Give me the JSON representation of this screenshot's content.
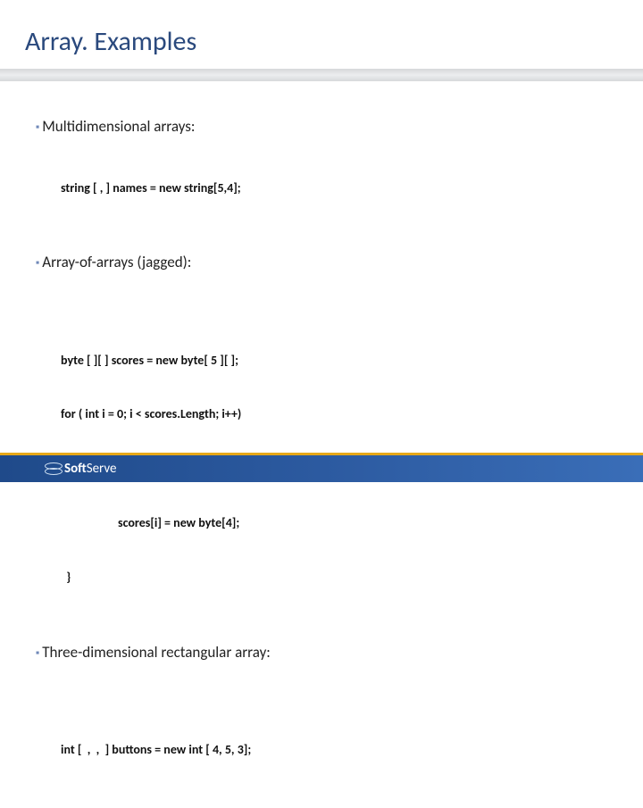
{
  "title": "Array. Examples",
  "sections": [
    {
      "heading": "Multidimensional arrays:",
      "code": [
        {
          "cls": "indent1",
          "text": "string [ , ] names = new string[5,4];"
        }
      ]
    },
    {
      "heading": "Array-of-arrays (jagged):",
      "code": [
        {
          "cls": "indent1",
          "text": ""
        },
        {
          "cls": "indent1",
          "text": "byte [ ][ ] scores = new byte[ 5 ][ ];"
        },
        {
          "cls": "indent1",
          "text": "for ( int i = 0; i < scores.Length; i++)"
        },
        {
          "cls": "indent1",
          "text": "{"
        },
        {
          "cls": "indent2",
          "text": "scores[i] = new byte[4];"
        },
        {
          "cls": "indent1",
          "text": "  }"
        }
      ]
    },
    {
      "heading": "Three-dimensional rectangular array:",
      "code": [
        {
          "cls": "indent1",
          "text": ""
        },
        {
          "cls": "indent1",
          "text": "int [  ,  ,  ] buttons = new int [ 4, 5, 3];"
        }
      ]
    }
  ],
  "footer": {
    "brand_bold": "Soft",
    "brand_rest": "Serve"
  }
}
